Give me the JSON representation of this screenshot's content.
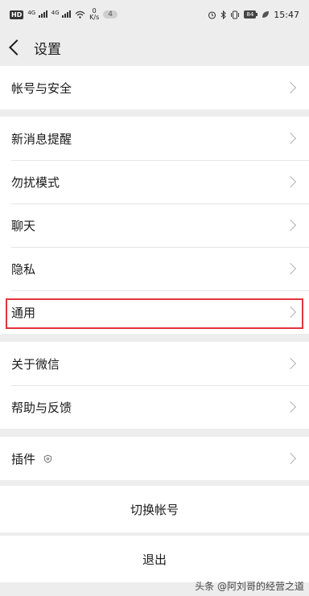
{
  "status_bar": {
    "hd": "HD",
    "net1": "4G",
    "net2": "4G",
    "speed_value": "0",
    "speed_unit": "K/s",
    "notification_count": "4",
    "battery": "84",
    "time": "15:47"
  },
  "header": {
    "title": "设置"
  },
  "groups": [
    {
      "items": [
        {
          "label": "帐号与安全"
        }
      ]
    },
    {
      "items": [
        {
          "label": "新消息提醒"
        },
        {
          "label": "勿扰模式"
        },
        {
          "label": "聊天"
        },
        {
          "label": "隐私"
        },
        {
          "label": "通用",
          "highlighted": true
        }
      ]
    },
    {
      "items": [
        {
          "label": "关于微信"
        },
        {
          "label": "帮助与反馈"
        }
      ]
    },
    {
      "items": [
        {
          "label": "插件",
          "icon": "shield-icon"
        }
      ]
    }
  ],
  "actions": {
    "switch_account": "切换帐号",
    "logout": "退出"
  },
  "watermark": "头条 @阿刘哥的经营之道",
  "colors": {
    "highlight": "#e3343b",
    "background": "#ededed"
  }
}
